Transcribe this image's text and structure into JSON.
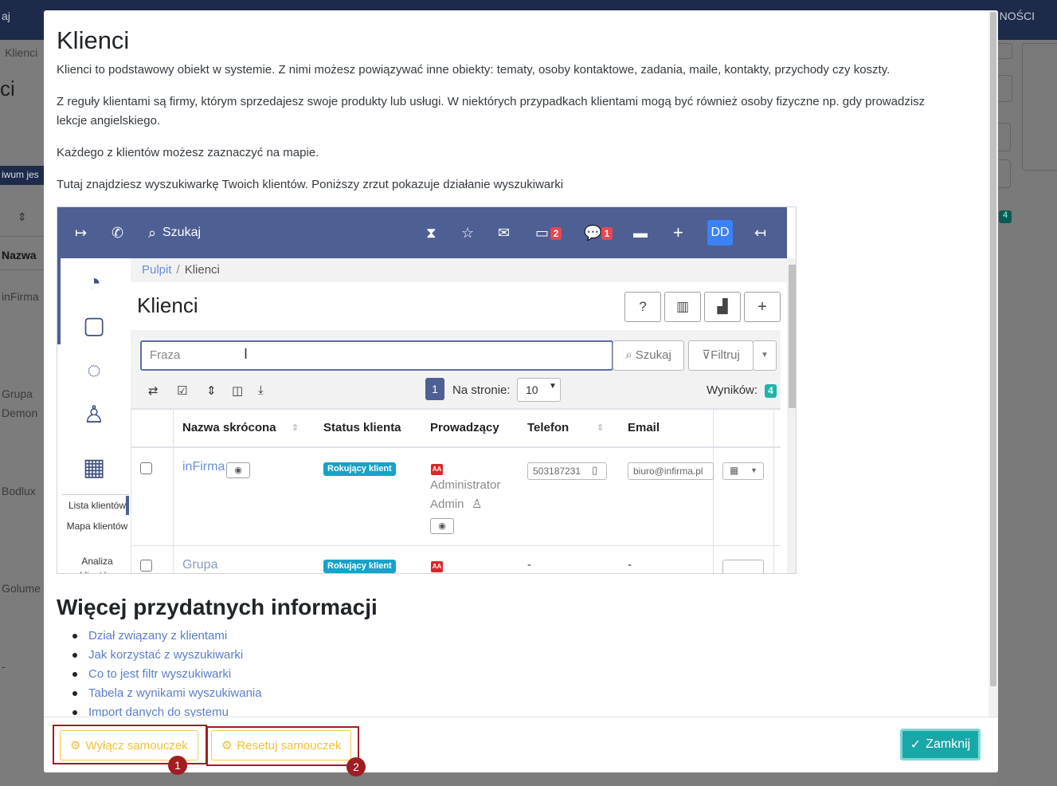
{
  "background": {
    "topbar_left": "aj",
    "topbar_right": "NOŚCI",
    "crumb": "Klienci",
    "title": "ci",
    "archive_label": "iwum jes",
    "table_header": "Nazwa",
    "rows": [
      "inFirma",
      "Grupa",
      "Demon",
      "Bodlux",
      "Golume",
      "-"
    ],
    "right_badge": "4"
  },
  "modal": {
    "title": "Klienci",
    "paragraphs": [
      "Klienci to podstawowy obiekt w systemie. Z nimi możesz powiązywać inne obiekty: tematy, osoby kontaktowe, zadania, maile, kontakty, przychody czy koszty.",
      "Z reguły klientami są firmy, którym sprzedajesz swoje produkty lub usługi. W niektórych przypadkach klientami mogą być również osoby fizyczne np. gdy prowadzisz lekcje angielskiego.",
      "Każdego z klientów możesz zaznaczyć na mapie.",
      "Tutaj znajdziesz wyszukiwarkę Twoich klientów. Poniższy zrzut pokazuje działanie wyszukiwarki"
    ],
    "more_info_title": "Więcej przydatnych informacji",
    "links": [
      "Dział związany z klientami",
      "Jak korzystać z wyszukiwarki",
      "Co to jest filtr wyszukiwarki",
      "Tabela z wynikami wyszukiwania",
      "Import danych do systemu"
    ],
    "footer": {
      "disable_tutorial": "Wyłącz samouczek",
      "reset_tutorial": "Resetuj samouczek",
      "close": "Zamknij",
      "annotation_1": "1",
      "annotation_2": "2"
    }
  },
  "screenshot": {
    "topbar": {
      "search_label": "Szukaj",
      "calendar_badge": "2",
      "chat_badge": "1",
      "user_initials": "DD"
    },
    "sidebar": {
      "items": [
        "Lista klientów",
        "Mapa klientów",
        "Analiza klientów"
      ]
    },
    "breadcrumb": {
      "root": "Pulpit",
      "separator": "/",
      "current": "Klienci"
    },
    "page_title": "Klienci",
    "search": {
      "placeholder": "Fraza",
      "search_button": "Szukaj",
      "filter_button": "Filtruj"
    },
    "pagination": {
      "page": "1",
      "per_page_label": "Na stronie:",
      "per_page_value": "10",
      "results_label": "Wyników:",
      "results_count": "4"
    },
    "table": {
      "columns": [
        "Nazwa skrócona",
        "Status klienta",
        "Prowadzący",
        "Telefon",
        "Email"
      ],
      "rows": [
        {
          "name": "inFirma",
          "status": "Rokujący klient",
          "owner_badge": "AA",
          "owner_line1": "Administrator",
          "owner_line2": "Admin",
          "phone": "503187231",
          "email": "biuro@infirma.pl"
        },
        {
          "name": "Grupa",
          "status": "Rokujący klient",
          "owner_badge": "AA",
          "phone": "-",
          "email": "-"
        }
      ]
    }
  }
}
